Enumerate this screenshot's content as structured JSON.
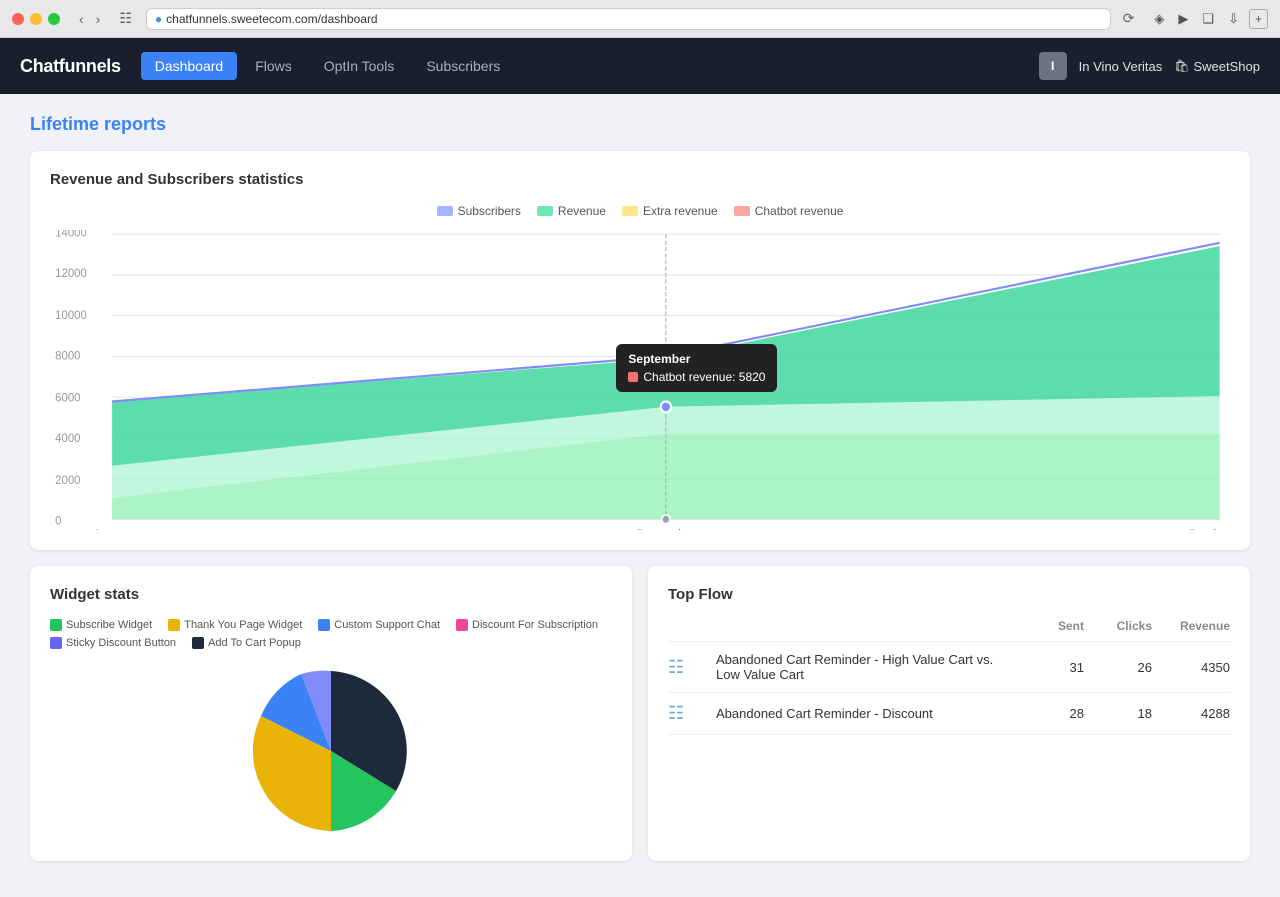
{
  "browser": {
    "url": "chatfunnels.sweetecom.com/dashboard",
    "traffic_lights": [
      "red",
      "yellow",
      "green"
    ]
  },
  "navbar": {
    "brand": "Chatfunnels",
    "links": [
      {
        "label": "Dashboard",
        "active": true
      },
      {
        "label": "Flows",
        "active": false
      },
      {
        "label": "OptIn Tools",
        "active": false
      },
      {
        "label": "Subscribers",
        "active": false
      }
    ],
    "user_initial": "I",
    "user_name": "In Vino Veritas",
    "shop_name": "SweetShop"
  },
  "page": {
    "title": "Lifetime reports"
  },
  "chart": {
    "title": "Revenue and Subscribers statistics",
    "legend": [
      {
        "label": "Subscribers",
        "color": "#a5b4fc"
      },
      {
        "label": "Revenue",
        "color": "#6ee7b7"
      },
      {
        "label": "Extra revenue",
        "color": "#fde68a"
      },
      {
        "label": "Chatbot revenue",
        "color": "#fca5a5"
      }
    ],
    "x_labels": [
      "August",
      "September",
      "October"
    ],
    "y_labels": [
      "0",
      "2000",
      "4000",
      "6000",
      "8000",
      "10000",
      "12000",
      "14000"
    ],
    "tooltip": {
      "title": "September",
      "label": "Chatbot revenue: 5820"
    }
  },
  "widget_stats": {
    "title": "Widget stats",
    "legend": [
      {
        "label": "Subscribe Widget",
        "color": "#22c55e"
      },
      {
        "label": "Thank You Page Widget",
        "color": "#eab308"
      },
      {
        "label": "Custom Support Chat",
        "color": "#3b82f6"
      },
      {
        "label": "Discount For Subscription",
        "color": "#ec4899"
      },
      {
        "label": "Sticky Discount Button",
        "color": "#6366f1"
      },
      {
        "label": "Add To Cart Popup",
        "color": "#1e293b"
      }
    ]
  },
  "top_flow": {
    "title": "Top Flow",
    "columns": [
      "",
      "",
      "Sent",
      "Clicks",
      "Revenue"
    ],
    "rows": [
      {
        "name": "Abandoned Cart Reminder - High Value Cart vs. Low Value Cart",
        "sent": 31,
        "clicks": 26,
        "revenue": 4350
      },
      {
        "name": "Abandoned Cart Reminder - Discount",
        "sent": 28,
        "clicks": 18,
        "revenue": 4288
      }
    ]
  }
}
